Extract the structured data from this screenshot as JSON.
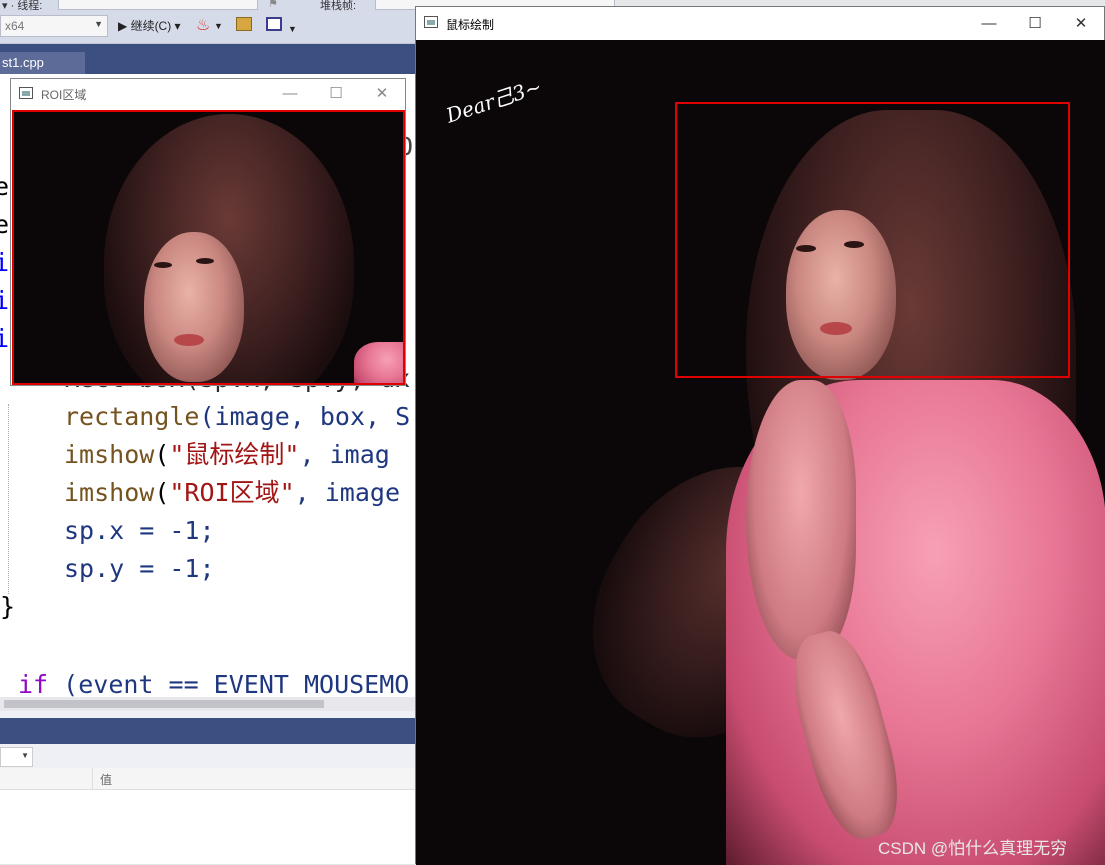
{
  "vs": {
    "topbar": {
      "label1": "▾ · 线程:",
      "label2": "堆栈帧:"
    },
    "toolbar": {
      "platform": "x64",
      "continue_label": "▶ 继续(C) ▾",
      "debug_icon": "fire-icon",
      "open_folder_icon": "folder-icon",
      "window_icon": "window-icon"
    },
    "tab_label": "st1.cpp",
    "code_lines": [
      {
        "text": "e"
      },
      {
        "text": "e"
      },
      {
        "text": "i"
      },
      {
        "text": "i"
      },
      {
        "text": "i"
      }
    ],
    "code_partial_line": "Rect box(sp.x, sp.y, dx",
    "code_tail_o": "O",
    "code": {
      "rectangle_fn": "rectangle",
      "rectangle_args": "(image, box, S",
      "imshow1_fn": "imshow",
      "imshow1_str": "\"鼠标绘制\"",
      "imshow1_rest": ", imag",
      "imshow2_fn": "imshow",
      "imshow2_str": "\"ROI区域\"",
      "imshow2_rest": ", image",
      "spx": "sp.x = -1;",
      "spy": "sp.y = -1;",
      "brace": "}",
      "if_kw": "if",
      "if_rest": " (event == EVENT_MOUSEMO"
    },
    "panel": {
      "column_value": "值"
    }
  },
  "roi_window": {
    "title": "ROI区域",
    "min": "—",
    "max": "☐",
    "close": "✕"
  },
  "main_window": {
    "title": "鼠标绘制",
    "min": "—",
    "max": "☐",
    "close": "✕",
    "signature": "Dear己3~",
    "watermark": "CSDN @怕什么真理无穷"
  },
  "colors": {
    "roi_border": "#e00000",
    "vs_tabstrip": "#3b4f81"
  }
}
